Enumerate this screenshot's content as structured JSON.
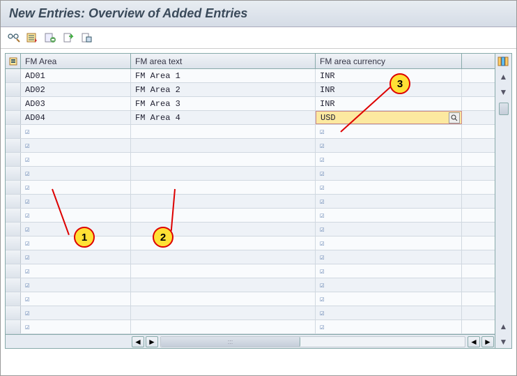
{
  "title": "New Entries: Overview of Added Entries",
  "toolbar": {
    "btn1_title": "Change/Display",
    "btn2_title": "Other Entry",
    "btn3_title": "Delete",
    "btn4_title": "Save",
    "btn5_title": "Select All"
  },
  "grid": {
    "headers": {
      "col1": "FM Area",
      "col2": "FM area text",
      "col3": "FM area currency"
    },
    "rows": [
      {
        "c1": "AD01",
        "c2": "FM Area 1",
        "c3": "INR",
        "active": false
      },
      {
        "c1": "AD02",
        "c2": "FM Area 2",
        "c3": "INR",
        "active": false
      },
      {
        "c1": "AD03",
        "c2": "FM Area 3",
        "c3": "INR",
        "active": false
      },
      {
        "c1": "AD04",
        "c2": "FM Area 4",
        "c3": "USD",
        "active": true
      }
    ],
    "empty_rows": 15
  },
  "callouts": {
    "c1": "1",
    "c2": "2",
    "c3": "3"
  }
}
